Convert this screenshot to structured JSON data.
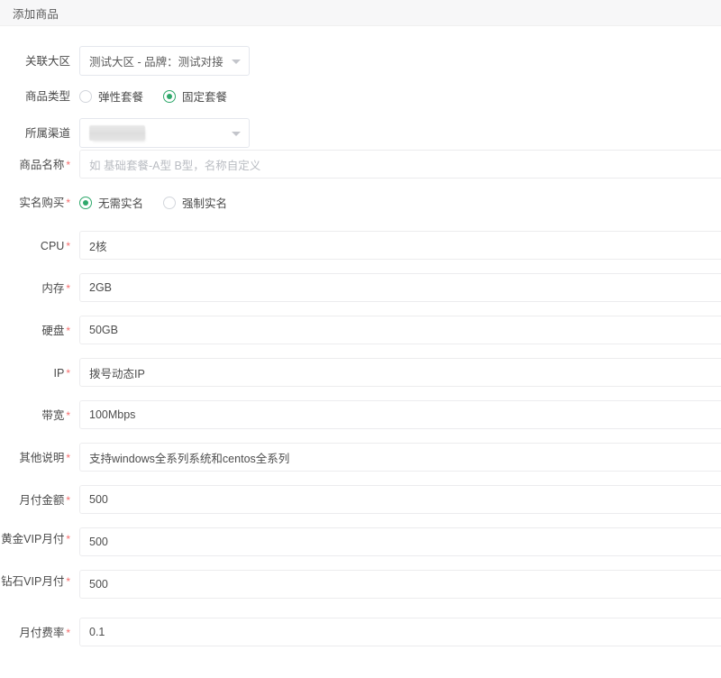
{
  "dialog": {
    "title": "添加商品"
  },
  "icons": {
    "dropdown": "chevron-down-icon"
  },
  "colors": {
    "accent_green": "#2fa86b",
    "required_red": "#f56c6c",
    "header_bg": "#f7f7f8",
    "border": "#e4e7ed",
    "text": "#4a4a4a",
    "placeholder": "#b9bcc2"
  },
  "form": {
    "region": {
      "label": "关联大区",
      "required": false,
      "value": "测试大区 - 品牌：测试对接"
    },
    "product_type": {
      "label": "商品类型",
      "required": false,
      "options": [
        {
          "label": "弹性套餐",
          "selected": false
        },
        {
          "label": "固定套餐",
          "selected": true
        }
      ]
    },
    "channel": {
      "label": "所属渠道",
      "required": false,
      "value": "",
      "redacted": true
    },
    "product_name": {
      "label": "商品名称",
      "required": true,
      "value": "",
      "placeholder": "如 基础套餐-A型  B型，名称自定义"
    },
    "realname_purchase": {
      "label": "实名购买",
      "required": true,
      "options": [
        {
          "label": "无需实名",
          "selected": true
        },
        {
          "label": "强制实名",
          "selected": false
        }
      ]
    },
    "cpu": {
      "label": "CPU",
      "required": true,
      "value": "2核"
    },
    "memory": {
      "label": "内存",
      "required": true,
      "value": "2GB"
    },
    "disk": {
      "label": "硬盘",
      "required": true,
      "value": "50GB"
    },
    "ip": {
      "label": "IP",
      "required": true,
      "value": "拨号动态IP"
    },
    "bandwidth": {
      "label": "带宽",
      "required": true,
      "value": "100Mbps"
    },
    "other_desc": {
      "label": "其他说明",
      "required": true,
      "value": "支持windows全系列系统和centos全系列"
    },
    "monthly_amount": {
      "label": "月付金额",
      "required": true,
      "value": "500"
    },
    "gold_vip_monthly": {
      "label": "黄金VIP月付",
      "required": true,
      "value": "500"
    },
    "diamond_vip_monthly": {
      "label": "钻石VIP月付",
      "required": true,
      "value": "500"
    },
    "monthly_rate": {
      "label": "月付费率",
      "required": true,
      "value": "0.1"
    }
  }
}
